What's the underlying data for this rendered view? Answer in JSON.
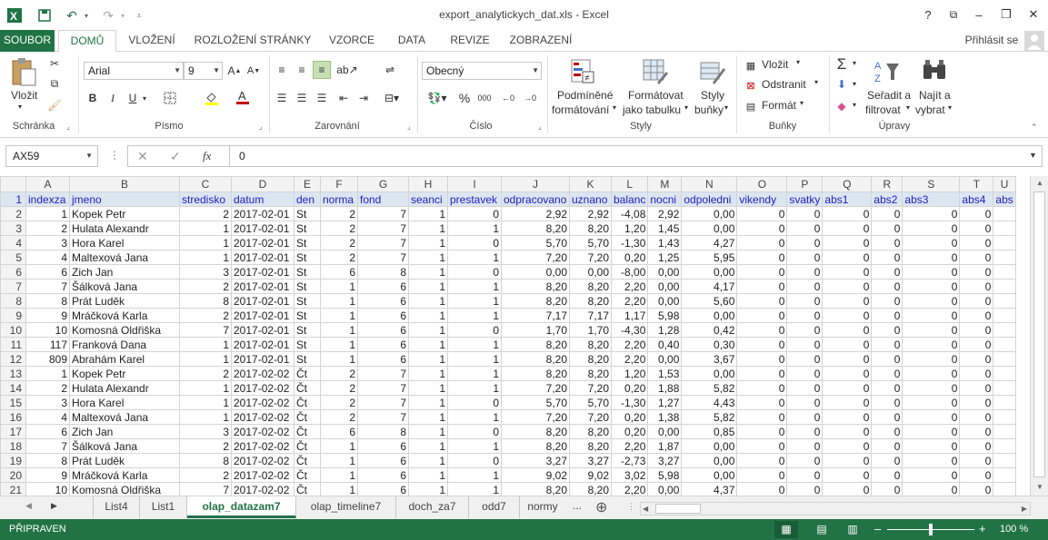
{
  "window": {
    "title": "export_analytickych_dat.xls - Excel",
    "help": "?",
    "min": "–",
    "restore": "❐",
    "close": "✕",
    "opts": "⧉"
  },
  "tabs": {
    "file": "SOUBOR",
    "items": [
      "DOMŮ",
      "VLOŽENÍ",
      "ROZLOŽENÍ STRÁNKY",
      "VZORCE",
      "DATA",
      "REVIZE",
      "ZOBRAZENÍ"
    ],
    "signin": "Přihlásit se"
  },
  "ribbon": {
    "clipboard": {
      "label": "Schránka",
      "paste": "Vložit"
    },
    "font": {
      "label": "Písmo",
      "name": "Arial",
      "size": "9",
      "bold": "B",
      "italic": "I",
      "underline": "U"
    },
    "alignment": {
      "label": "Zarovnání"
    },
    "number": {
      "label": "Číslo",
      "format": "Obecný"
    },
    "styles": {
      "label": "Styly",
      "cond_1": "Podmíněné",
      "cond_2": "formátování",
      "table_1": "Formátovat",
      "table_2": "jako tabulku",
      "cell_1": "Styly",
      "cell_2": "buňky"
    },
    "cells": {
      "label": "Buňky",
      "insert": "Vložit",
      "delete": "Odstranit",
      "format": "Formát"
    },
    "editing": {
      "label": "Úpravy",
      "sort_1": "Seřadit a",
      "sort_2": "filtrovat",
      "find_1": "Najít a",
      "find_2": "vybrat"
    }
  },
  "formula_bar": {
    "name_box": "AX59",
    "fx": "fx",
    "value": "0"
  },
  "columns": [
    "A",
    "B",
    "C",
    "D",
    "E",
    "F",
    "G",
    "H",
    "I",
    "J",
    "K",
    "L",
    "M",
    "N",
    "O",
    "P",
    "Q",
    "R",
    "S",
    "T",
    "U"
  ],
  "header_row": [
    "indexza",
    "jmeno",
    "stredisko",
    "datum",
    "den",
    "norma",
    "fond",
    "seanci",
    "prestavek",
    "odpracovano",
    "uznano",
    "balanc",
    "nocni",
    "odpoledni",
    "vikendy",
    "svatky",
    "abs1",
    "abs2",
    "abs3",
    "abs4",
    "abs"
  ],
  "rows": [
    [
      "1",
      "Kopek Petr",
      "2",
      "2017-02-01",
      "St",
      "2",
      "7",
      "1",
      "0",
      "2,92",
      "2,92",
      "-4,08",
      "2,92",
      "0,00",
      "0",
      "0",
      "0",
      "0",
      "0",
      "0"
    ],
    [
      "2",
      "Hulata Alexandr",
      "1",
      "2017-02-01",
      "St",
      "2",
      "7",
      "1",
      "1",
      "8,20",
      "8,20",
      "1,20",
      "1,45",
      "0,00",
      "0",
      "0",
      "0",
      "0",
      "0",
      "0"
    ],
    [
      "3",
      "Hora Karel",
      "1",
      "2017-02-01",
      "St",
      "2",
      "7",
      "1",
      "0",
      "5,70",
      "5,70",
      "-1,30",
      "1,43",
      "4,27",
      "0",
      "0",
      "0",
      "0",
      "0",
      "0"
    ],
    [
      "4",
      "Maltexová Jana",
      "1",
      "2017-02-01",
      "St",
      "2",
      "7",
      "1",
      "1",
      "7,20",
      "7,20",
      "0,20",
      "1,25",
      "5,95",
      "0",
      "0",
      "0",
      "0",
      "0",
      "0"
    ],
    [
      "6",
      "Zich Jan",
      "3",
      "2017-02-01",
      "St",
      "6",
      "8",
      "1",
      "0",
      "0,00",
      "0,00",
      "-8,00",
      "0,00",
      "0,00",
      "0",
      "0",
      "0",
      "0",
      "0",
      "0"
    ],
    [
      "7",
      "Šálková Jana",
      "2",
      "2017-02-01",
      "St",
      "1",
      "6",
      "1",
      "1",
      "8,20",
      "8,20",
      "2,20",
      "0,00",
      "4,17",
      "0",
      "0",
      "0",
      "0",
      "0",
      "0"
    ],
    [
      "8",
      "Prát Luděk",
      "8",
      "2017-02-01",
      "St",
      "1",
      "6",
      "1",
      "1",
      "8,20",
      "8,20",
      "2,20",
      "0,00",
      "5,60",
      "0",
      "0",
      "0",
      "0",
      "0",
      "0"
    ],
    [
      "9",
      "Mráčková Karla",
      "2",
      "2017-02-01",
      "St",
      "1",
      "6",
      "1",
      "1",
      "7,17",
      "7,17",
      "1,17",
      "5,98",
      "0,00",
      "0",
      "0",
      "0",
      "0",
      "0",
      "0"
    ],
    [
      "10",
      "Komosná Oldřiška",
      "7",
      "2017-02-01",
      "St",
      "1",
      "6",
      "1",
      "0",
      "1,70",
      "1,70",
      "-4,30",
      "1,28",
      "0,42",
      "0",
      "0",
      "0",
      "0",
      "0",
      "0"
    ],
    [
      "117",
      "Franková Dana",
      "1",
      "2017-02-01",
      "St",
      "1",
      "6",
      "1",
      "1",
      "8,20",
      "8,20",
      "2,20",
      "0,40",
      "0,30",
      "0",
      "0",
      "0",
      "0",
      "0",
      "0"
    ],
    [
      "809",
      "Abrahám Karel",
      "1",
      "2017-02-01",
      "St",
      "1",
      "6",
      "1",
      "1",
      "8,20",
      "8,20",
      "2,20",
      "0,00",
      "3,67",
      "0",
      "0",
      "0",
      "0",
      "0",
      "0"
    ],
    [
      "1",
      "Kopek Petr",
      "2",
      "2017-02-02",
      "Čt",
      "2",
      "7",
      "1",
      "1",
      "8,20",
      "8,20",
      "1,20",
      "1,53",
      "0,00",
      "0",
      "0",
      "0",
      "0",
      "0",
      "0"
    ],
    [
      "2",
      "Hulata Alexandr",
      "1",
      "2017-02-02",
      "Čt",
      "2",
      "7",
      "1",
      "1",
      "7,20",
      "7,20",
      "0,20",
      "1,88",
      "5,82",
      "0",
      "0",
      "0",
      "0",
      "0",
      "0"
    ],
    [
      "3",
      "Hora Karel",
      "1",
      "2017-02-02",
      "Čt",
      "2",
      "7",
      "1",
      "0",
      "5,70",
      "5,70",
      "-1,30",
      "1,27",
      "4,43",
      "0",
      "0",
      "0",
      "0",
      "0",
      "0"
    ],
    [
      "4",
      "Maltexová Jana",
      "1",
      "2017-02-02",
      "Čt",
      "2",
      "7",
      "1",
      "1",
      "7,20",
      "7,20",
      "0,20",
      "1,38",
      "5,82",
      "0",
      "0",
      "0",
      "0",
      "0",
      "0"
    ],
    [
      "6",
      "Zich Jan",
      "3",
      "2017-02-02",
      "Čt",
      "6",
      "8",
      "1",
      "0",
      "8,20",
      "8,20",
      "0,20",
      "0,00",
      "0,85",
      "0",
      "0",
      "0",
      "0",
      "0",
      "0"
    ],
    [
      "7",
      "Šálková Jana",
      "2",
      "2017-02-02",
      "Čt",
      "1",
      "6",
      "1",
      "1",
      "8,20",
      "8,20",
      "2,20",
      "1,87",
      "0,00",
      "0",
      "0",
      "0",
      "0",
      "0",
      "0"
    ],
    [
      "8",
      "Prát Luděk",
      "8",
      "2017-02-02",
      "Čt",
      "1",
      "6",
      "1",
      "0",
      "3,27",
      "3,27",
      "-2,73",
      "3,27",
      "0,00",
      "0",
      "0",
      "0",
      "0",
      "0",
      "0"
    ],
    [
      "9",
      "Mráčková Karla",
      "2",
      "2017-02-02",
      "Čt",
      "1",
      "6",
      "1",
      "1",
      "9,02",
      "9,02",
      "3,02",
      "5,98",
      "0,00",
      "0",
      "0",
      "0",
      "0",
      "0",
      "0"
    ],
    [
      "10",
      "Komosná Oldřiška",
      "7",
      "2017-02-02",
      "Čt",
      "1",
      "6",
      "1",
      "1",
      "8,20",
      "8,20",
      "2,20",
      "0,00",
      "4,37",
      "0",
      "0",
      "0",
      "0",
      "0",
      "0"
    ]
  ],
  "sheet_tabs": {
    "items": [
      "List4",
      "List1",
      "olap_datazam7",
      "olap_timeline7",
      "doch_za7",
      "odd7",
      "normy"
    ],
    "active": 2,
    "more": "...",
    "add": "⊕"
  },
  "status": {
    "ready": "PŘIPRAVEN",
    "zoom": "100 %",
    "minus": "–",
    "plus": "+"
  },
  "colors": {
    "accent": "#217346",
    "header_fill": "#dce6f1",
    "header_text": "#2020c0"
  }
}
